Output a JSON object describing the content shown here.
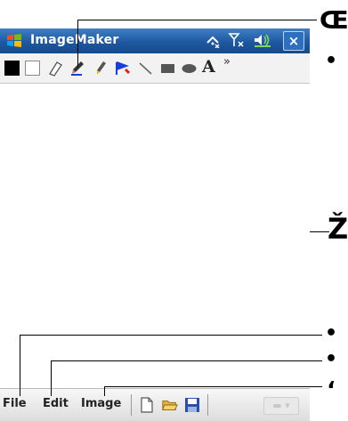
{
  "window": {
    "title": "ImageMaker",
    "close_label": "×",
    "status_icons": [
      "signal-wifi-icon",
      "antenna-icon",
      "volume-icon"
    ]
  },
  "toolbar": {
    "tools": [
      "black-color-swatch",
      "white-color-swatch",
      "eraser-icon",
      "pencil-icon",
      "marker-icon",
      "fill-bucket-icon",
      "line-icon",
      "rectangle-icon",
      "ellipse-icon",
      "text-icon",
      "more-tools-icon"
    ],
    "text_tool_label": "A",
    "more_label": "»"
  },
  "menu": {
    "file": "File",
    "edit": "Edit",
    "image": "Image",
    "buttons": [
      "new-file-icon",
      "open-folder-icon",
      "save-disk-icon"
    ],
    "keyboard_label": "▬ ▾"
  },
  "callouts": {
    "top": "Œ",
    "toolbar": "•",
    "canvas": "Ž",
    "file": "•",
    "edit": "•",
    "image": "‘"
  }
}
